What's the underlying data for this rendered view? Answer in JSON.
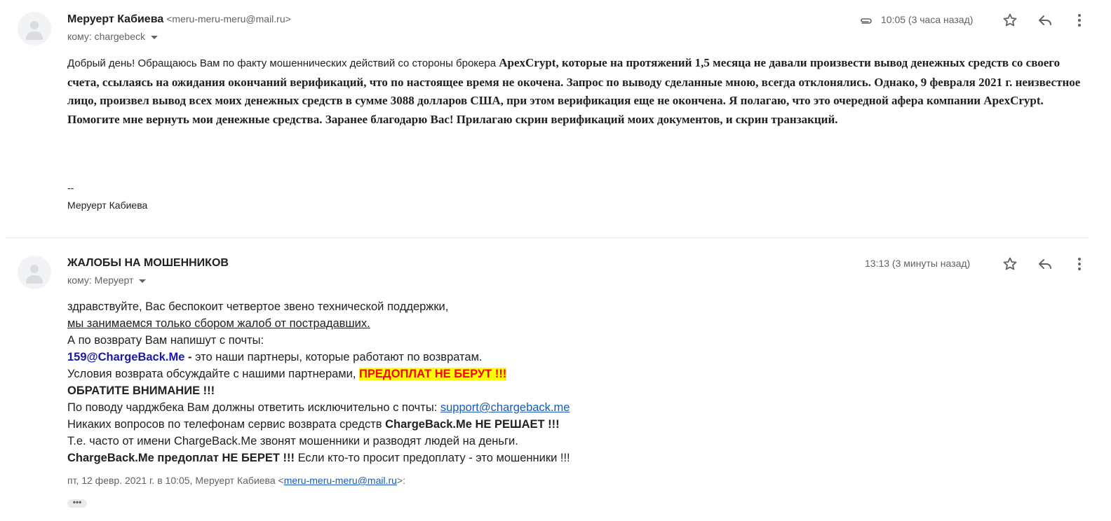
{
  "message1": {
    "sender_name": "Меруерт Кабиева",
    "sender_email": "<meru-meru-meru@mail.ru>",
    "to_label": "кому: chargebeck",
    "time": "10:05 (3 часа назад)",
    "body_lead": "Добрый день! Обращаюсь Вам по факту мошеннических действий со стороны брокера ",
    "body_main": "ApexCrypt, которые на протяжений 1,5 месяца не давали произвести вывод денежных средств со своего счета, ссылаясь на ожидания окончаний верификаций, что по настоящее время не окочена. Запрос по выводу сделанные мною, всегда отклонялись. Однако, 9 февраля 2021 г. неизвестное лицо, произвел вывод всех моих денежных средств в сумме 3088 долларов США, при этом верификация еще не окончена. Я полагаю, что это очередной афера компании ApexCrypt.  Помогите мне вернуть мои денежные средства. Заранее благодарю Вас! Прилагаю скрин верификаций моих документов, и скрин транзакций.",
    "sig_dash": "--",
    "sig_name": "Меруерт Кабиева"
  },
  "message2": {
    "sender_name": "ЖАЛОБЫ НА МОШЕННИКОВ",
    "to_label": "кому: Меруерт",
    "time": "13:13 (3 минуты назад)",
    "line1": "здравствуйте, Вас беспокоит четвертое звено технической поддержки,",
    "line2": "мы занимаемся только сбором жалоб от пострадавших.",
    "line3": "А по возврату Вам напишут с почты:",
    "line4_email": "159@ChargeBack.Me",
    "line4_dash": " - ",
    "line4_rest": "это наши партнеры, которые работают по возвратам.",
    "line5_text": "Условия возврата обсуждайте с нашими партнерами, ",
    "line5_highlight": "ПРЕДОПЛАТ НЕ БЕРУТ !!!",
    "line6": "ОБРАТИТЕ ВНИМАНИЕ !!!",
    "line7_text": "По поводу чарджбека Вам должны ответить исключительно с почты: ",
    "line7_link": "support@chargeback.me",
    "line8_text": "Никаких вопросов по телефонам сервис возврата средств ",
    "line8_bold": "ChargeBack.Me НЕ РЕШАЕТ !!!",
    "line9": "Т.е. часто от имени ChargeBack.Me звонят мошенники и разводят людей на деньги.",
    "line10_bold": "ChargeBack.Me предоплат НЕ БЕРЕТ !!!",
    "line10_text": " Если кто-то просит предоплату - это мошенники !!!",
    "quote_prefix": "пт, 12 февр. 2021 г. в 10:05, Меруерт Кабиева <",
    "quote_email": "meru-meru-meru@mail.ru",
    "quote_suffix": ">:",
    "ellipsis": "•••"
  }
}
